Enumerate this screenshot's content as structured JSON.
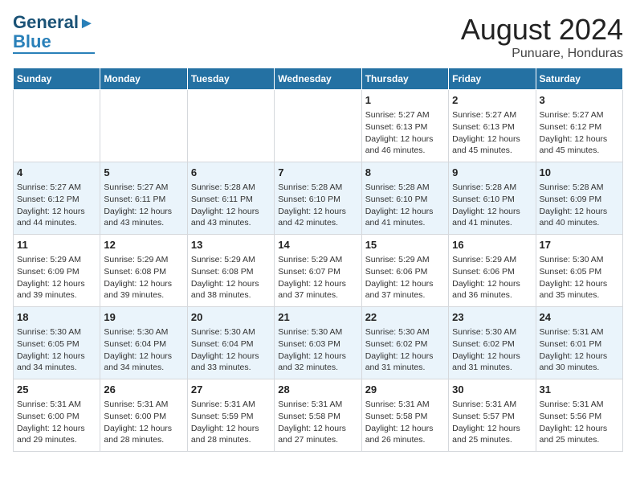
{
  "header": {
    "logo_line1": "General",
    "logo_line2": "Blue",
    "title": "August 2024",
    "subtitle": "Punuare, Honduras"
  },
  "columns": [
    "Sunday",
    "Monday",
    "Tuesday",
    "Wednesday",
    "Thursday",
    "Friday",
    "Saturday"
  ],
  "weeks": [
    [
      {
        "day": "",
        "content": ""
      },
      {
        "day": "",
        "content": ""
      },
      {
        "day": "",
        "content": ""
      },
      {
        "day": "",
        "content": ""
      },
      {
        "day": "1",
        "content": "Sunrise: 5:27 AM\nSunset: 6:13 PM\nDaylight: 12 hours\nand 46 minutes."
      },
      {
        "day": "2",
        "content": "Sunrise: 5:27 AM\nSunset: 6:13 PM\nDaylight: 12 hours\nand 45 minutes."
      },
      {
        "day": "3",
        "content": "Sunrise: 5:27 AM\nSunset: 6:12 PM\nDaylight: 12 hours\nand 45 minutes."
      }
    ],
    [
      {
        "day": "4",
        "content": "Sunrise: 5:27 AM\nSunset: 6:12 PM\nDaylight: 12 hours\nand 44 minutes."
      },
      {
        "day": "5",
        "content": "Sunrise: 5:27 AM\nSunset: 6:11 PM\nDaylight: 12 hours\nand 43 minutes."
      },
      {
        "day": "6",
        "content": "Sunrise: 5:28 AM\nSunset: 6:11 PM\nDaylight: 12 hours\nand 43 minutes."
      },
      {
        "day": "7",
        "content": "Sunrise: 5:28 AM\nSunset: 6:10 PM\nDaylight: 12 hours\nand 42 minutes."
      },
      {
        "day": "8",
        "content": "Sunrise: 5:28 AM\nSunset: 6:10 PM\nDaylight: 12 hours\nand 41 minutes."
      },
      {
        "day": "9",
        "content": "Sunrise: 5:28 AM\nSunset: 6:10 PM\nDaylight: 12 hours\nand 41 minutes."
      },
      {
        "day": "10",
        "content": "Sunrise: 5:28 AM\nSunset: 6:09 PM\nDaylight: 12 hours\nand 40 minutes."
      }
    ],
    [
      {
        "day": "11",
        "content": "Sunrise: 5:29 AM\nSunset: 6:09 PM\nDaylight: 12 hours\nand 39 minutes."
      },
      {
        "day": "12",
        "content": "Sunrise: 5:29 AM\nSunset: 6:08 PM\nDaylight: 12 hours\nand 39 minutes."
      },
      {
        "day": "13",
        "content": "Sunrise: 5:29 AM\nSunset: 6:08 PM\nDaylight: 12 hours\nand 38 minutes."
      },
      {
        "day": "14",
        "content": "Sunrise: 5:29 AM\nSunset: 6:07 PM\nDaylight: 12 hours\nand 37 minutes."
      },
      {
        "day": "15",
        "content": "Sunrise: 5:29 AM\nSunset: 6:06 PM\nDaylight: 12 hours\nand 37 minutes."
      },
      {
        "day": "16",
        "content": "Sunrise: 5:29 AM\nSunset: 6:06 PM\nDaylight: 12 hours\nand 36 minutes."
      },
      {
        "day": "17",
        "content": "Sunrise: 5:30 AM\nSunset: 6:05 PM\nDaylight: 12 hours\nand 35 minutes."
      }
    ],
    [
      {
        "day": "18",
        "content": "Sunrise: 5:30 AM\nSunset: 6:05 PM\nDaylight: 12 hours\nand 34 minutes."
      },
      {
        "day": "19",
        "content": "Sunrise: 5:30 AM\nSunset: 6:04 PM\nDaylight: 12 hours\nand 34 minutes."
      },
      {
        "day": "20",
        "content": "Sunrise: 5:30 AM\nSunset: 6:04 PM\nDaylight: 12 hours\nand 33 minutes."
      },
      {
        "day": "21",
        "content": "Sunrise: 5:30 AM\nSunset: 6:03 PM\nDaylight: 12 hours\nand 32 minutes."
      },
      {
        "day": "22",
        "content": "Sunrise: 5:30 AM\nSunset: 6:02 PM\nDaylight: 12 hours\nand 31 minutes."
      },
      {
        "day": "23",
        "content": "Sunrise: 5:30 AM\nSunset: 6:02 PM\nDaylight: 12 hours\nand 31 minutes."
      },
      {
        "day": "24",
        "content": "Sunrise: 5:31 AM\nSunset: 6:01 PM\nDaylight: 12 hours\nand 30 minutes."
      }
    ],
    [
      {
        "day": "25",
        "content": "Sunrise: 5:31 AM\nSunset: 6:00 PM\nDaylight: 12 hours\nand 29 minutes."
      },
      {
        "day": "26",
        "content": "Sunrise: 5:31 AM\nSunset: 6:00 PM\nDaylight: 12 hours\nand 28 minutes."
      },
      {
        "day": "27",
        "content": "Sunrise: 5:31 AM\nSunset: 5:59 PM\nDaylight: 12 hours\nand 28 minutes."
      },
      {
        "day": "28",
        "content": "Sunrise: 5:31 AM\nSunset: 5:58 PM\nDaylight: 12 hours\nand 27 minutes."
      },
      {
        "day": "29",
        "content": "Sunrise: 5:31 AM\nSunset: 5:58 PM\nDaylight: 12 hours\nand 26 minutes."
      },
      {
        "day": "30",
        "content": "Sunrise: 5:31 AM\nSunset: 5:57 PM\nDaylight: 12 hours\nand 25 minutes."
      },
      {
        "day": "31",
        "content": "Sunrise: 5:31 AM\nSunset: 5:56 PM\nDaylight: 12 hours\nand 25 minutes."
      }
    ]
  ]
}
